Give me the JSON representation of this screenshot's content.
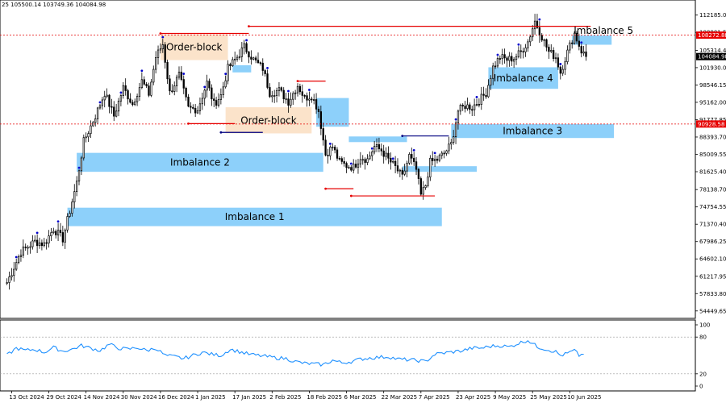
{
  "header": {
    "ohlc_text": "25 105500.14 103749.36 104084.98"
  },
  "chart_data": {
    "type": "candlestick",
    "price_axis": {
      "ticks": [
        112185.0,
        108801.55,
        105314.45,
        101930.0,
        98546.15,
        95162.0,
        91777.85,
        88393.7,
        85009.55,
        81625.4,
        78138.7,
        74754.55,
        71370.4,
        67986.25,
        64602.1,
        61217.95,
        57833.8,
        54449.65
      ],
      "tick_labels": [
        "112185.00",
        "108801.55",
        "105314.45",
        "101930.00",
        "98546.15",
        "95162.00",
        "91777.85",
        "88393.70",
        "85009.55",
        "81625.40",
        "78138.70",
        "74754.55",
        "71370.40",
        "67986.25",
        "64602.10",
        "61217.95",
        "57833.80",
        "54449.65"
      ],
      "ylim": [
        53000,
        114500
      ]
    },
    "time_axis": {
      "labels": [
        "13 Oct 2024",
        "29 Oct 2024",
        "14 Nov 2024",
        "30 Nov 2024",
        "16 Dec 2024",
        "1 Jan 2025",
        "17 Jan 2025",
        "2 Feb 2025",
        "18 Feb 2025",
        "6 Mar 2025",
        "22 Mar 2025",
        "7 Apr 2025",
        "23 Apr 2025",
        "9 May 2025",
        "25 May 2025",
        "10 Jun 2025"
      ],
      "label_days": [
        2,
        18,
        34,
        50,
        66,
        82,
        98,
        114,
        130,
        146,
        162,
        178,
        194,
        210,
        226,
        242
      ],
      "xlim": [
        -3,
        296
      ]
    },
    "price_tags": [
      {
        "label": "108272.88",
        "value": 108272.88,
        "color": "#e60000"
      },
      {
        "label": "104084.98",
        "value": 104084.98,
        "color": "#000000"
      },
      {
        "label": "90928.58",
        "value": 90928.58,
        "color": "#e60000"
      }
    ],
    "horizontal_dashed": [
      {
        "value": 108272.88,
        "color": "#e60000"
      },
      {
        "value": 90928.58,
        "color": "#e60000"
      }
    ],
    "zones": [
      {
        "label": "Imbalance 1",
        "x0": 26,
        "x1": 187,
        "y0": 71000,
        "y1": 74600,
        "color": "#87cefa"
      },
      {
        "label": "Imbalance 2",
        "x0": 30,
        "x1": 136,
        "y0": 81600,
        "y1": 85300,
        "color": "#87cefa"
      },
      {
        "label": "",
        "x0": 133,
        "x1": 147,
        "y0": 90400,
        "y1": 96000,
        "color": "#87cefa"
      },
      {
        "label": "",
        "x0": 147,
        "x1": 172,
        "y0": 87400,
        "y1": 88500,
        "color": "#87cefa"
      },
      {
        "label": "",
        "x0": 170,
        "x1": 202,
        "y0": 81600,
        "y1": 82700,
        "color": "#87cefa"
      },
      {
        "label": "Imbalance 3",
        "x0": 191,
        "x1": 261,
        "y0": 88200,
        "y1": 90900,
        "color": "#87cefa"
      },
      {
        "label": "Imbalance 4",
        "x0": 207,
        "x1": 237,
        "y0": 97800,
        "y1": 102000,
        "color": "#87cefa"
      },
      {
        "label": "Imbalance 5",
        "x0": 243,
        "x1": 260,
        "y0": 106400,
        "y1": 108200,
        "color": "#87cefa"
      },
      {
        "label": "",
        "x0": 97,
        "x1": 105,
        "y0": 101000,
        "y1": 102400,
        "color": "#87cefa"
      },
      {
        "label": "Order-block",
        "x0": 66,
        "x1": 95,
        "y0": 103400,
        "y1": 108400,
        "color": "#fbe2c7"
      },
      {
        "label": "Order-block",
        "x0": 94,
        "x1": 131,
        "y0": 89100,
        "y1": 94200,
        "color": "#fbe2c7"
      }
    ],
    "level_lines": [
      {
        "x0": 66,
        "x1": 104,
        "value": 108600,
        "color": "#e60000"
      },
      {
        "x0": 104,
        "x1": 251,
        "value": 110000,
        "color": "#e60000"
      },
      {
        "x0": 78,
        "x1": 98,
        "value": 91000,
        "color": "#e60000"
      },
      {
        "x0": 92,
        "x1": 110,
        "value": 89300,
        "color": "#000080"
      },
      {
        "x0": 125,
        "x1": 137,
        "value": 99300,
        "color": "#e60000"
      },
      {
        "x0": 137,
        "x1": 149,
        "value": 78300,
        "color": "#e60000"
      },
      {
        "x0": 148,
        "x1": 184,
        "value": 76900,
        "color": "#e60000"
      },
      {
        "x0": 170,
        "x1": 190,
        "value": 88600,
        "color": "#000080"
      }
    ],
    "anchors": [
      [
        0,
        60000
      ],
      [
        6,
        66000
      ],
      [
        12,
        68000
      ],
      [
        16,
        67500
      ],
      [
        20,
        70500
      ],
      [
        24,
        68500
      ],
      [
        27,
        74000
      ],
      [
        30,
        79500
      ],
      [
        33,
        87500
      ],
      [
        38,
        92500
      ],
      [
        42,
        97000
      ],
      [
        46,
        92500
      ],
      [
        50,
        98000
      ],
      [
        54,
        94800
      ],
      [
        58,
        99300
      ],
      [
        61,
        96800
      ],
      [
        64,
        104000
      ],
      [
        67,
        106500
      ],
      [
        70,
        97000
      ],
      [
        74,
        100500
      ],
      [
        78,
        94000
      ],
      [
        82,
        93800
      ],
      [
        86,
        99000
      ],
      [
        89,
        94800
      ],
      [
        92,
        96500
      ],
      [
        95,
        101800
      ],
      [
        99,
        104000
      ],
      [
        102,
        106000
      ],
      [
        106,
        103500
      ],
      [
        110,
        101800
      ],
      [
        113,
        97000
      ],
      [
        117,
        97500
      ],
      [
        121,
        95300
      ],
      [
        125,
        98500
      ],
      [
        128,
        96000
      ],
      [
        131,
        96500
      ],
      [
        134,
        93500
      ],
      [
        137,
        85000
      ],
      [
        140,
        86500
      ],
      [
        143,
        83500
      ],
      [
        146,
        82800
      ],
      [
        149,
        82500
      ],
      [
        152,
        84500
      ],
      [
        155,
        84000
      ],
      [
        158,
        86500
      ],
      [
        161,
        85800
      ],
      [
        164,
        84000
      ],
      [
        167,
        82500
      ],
      [
        170,
        80500
      ],
      [
        173,
        84700
      ],
      [
        176,
        82000
      ],
      [
        178,
        77000
      ],
      [
        180,
        79000
      ],
      [
        182,
        83500
      ],
      [
        185,
        84000
      ],
      [
        188,
        85200
      ],
      [
        191,
        87000
      ],
      [
        194,
        93500
      ],
      [
        197,
        94500
      ],
      [
        200,
        94200
      ],
      [
        203,
        95500
      ],
      [
        206,
        97000
      ],
      [
        209,
        102000
      ],
      [
        212,
        104000
      ],
      [
        215,
        103500
      ],
      [
        218,
        103800
      ],
      [
        221,
        105000
      ],
      [
        224,
        107000
      ],
      [
        227,
        111000
      ],
      [
        230,
        108000
      ],
      [
        233,
        105000
      ],
      [
        236,
        104000
      ],
      [
        238,
        101000
      ],
      [
        241,
        105000
      ],
      [
        244,
        108600
      ],
      [
        247,
        105200
      ],
      [
        249,
        104084.98
      ]
    ],
    "indicator": {
      "name": "",
      "levels": [
        100,
        80,
        20,
        0
      ],
      "level_labels": [
        "100",
        "80",
        "20",
        "0"
      ],
      "ylim": [
        0,
        100
      ],
      "anchors": [
        [
          0,
          50
        ],
        [
          4,
          62
        ],
        [
          8,
          58
        ],
        [
          12,
          60
        ],
        [
          16,
          55
        ],
        [
          20,
          63
        ],
        [
          24,
          57
        ],
        [
          28,
          60
        ],
        [
          32,
          66
        ],
        [
          36,
          62
        ],
        [
          40,
          58
        ],
        [
          44,
          68
        ],
        [
          48,
          62
        ],
        [
          52,
          60
        ],
        [
          56,
          63
        ],
        [
          60,
          58
        ],
        [
          64,
          62
        ],
        [
          68,
          50
        ],
        [
          72,
          48
        ],
        [
          76,
          45
        ],
        [
          80,
          50
        ],
        [
          84,
          55
        ],
        [
          88,
          52
        ],
        [
          92,
          50
        ],
        [
          96,
          60
        ],
        [
          100,
          56
        ],
        [
          104,
          52
        ],
        [
          108,
          50
        ],
        [
          112,
          48
        ],
        [
          116,
          46
        ],
        [
          120,
          45
        ],
        [
          124,
          40
        ],
        [
          128,
          37
        ],
        [
          132,
          36
        ],
        [
          136,
          35
        ],
        [
          140,
          42
        ],
        [
          144,
          38
        ],
        [
          148,
          40
        ],
        [
          152,
          44
        ],
        [
          156,
          46
        ],
        [
          160,
          47
        ],
        [
          164,
          48
        ],
        [
          168,
          44
        ],
        [
          172,
          43
        ],
        [
          176,
          42
        ],
        [
          180,
          40
        ],
        [
          184,
          52
        ],
        [
          188,
          54
        ],
        [
          192,
          56
        ],
        [
          196,
          58
        ],
        [
          200,
          62
        ],
        [
          204,
          62
        ],
        [
          208,
          65
        ],
        [
          212,
          66
        ],
        [
          216,
          64
        ],
        [
          220,
          70
        ],
        [
          224,
          75
        ],
        [
          228,
          64
        ],
        [
          232,
          60
        ],
        [
          236,
          56
        ],
        [
          238,
          50
        ],
        [
          240,
          52
        ],
        [
          244,
          58
        ],
        [
          246,
          50
        ],
        [
          248,
          52
        ]
      ]
    }
  },
  "colors": {
    "bull": "#000000",
    "bear": "#000000",
    "indicator_line": "#1e90ff",
    "marker": "#0000cc"
  }
}
